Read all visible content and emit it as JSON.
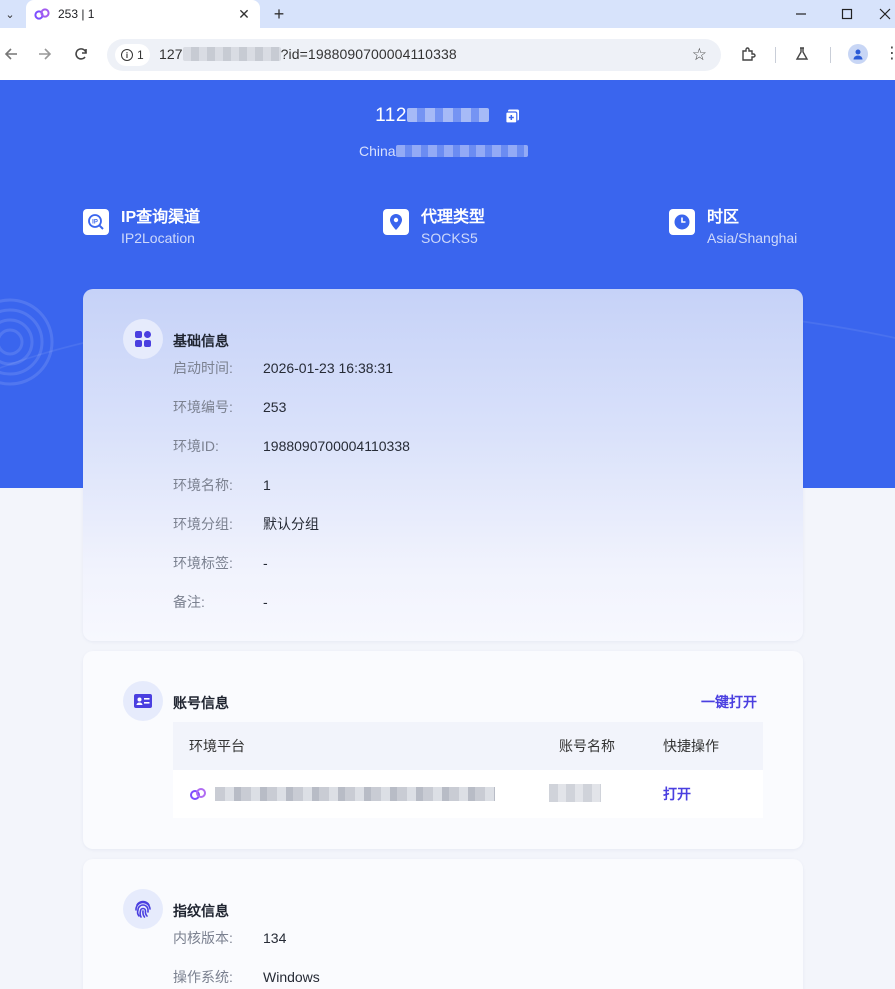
{
  "browser": {
    "tab_title": "253 | 1",
    "tab_caret": "⌄",
    "tab_close": "✕",
    "new_tab": "+",
    "site_info_count": "1",
    "url_prefix": "127",
    "url_suffix": "?id=1988090700004110338"
  },
  "proxy": {
    "ip_prefix": "112",
    "location_prefix": "China"
  },
  "stats": [
    {
      "label": "IP查询渠道",
      "value": "IP2Location",
      "icon": "ip-search-icon"
    },
    {
      "label": "代理类型",
      "value": "SOCKS5",
      "icon": "location-pin-icon"
    },
    {
      "label": "时区",
      "value": "Asia/Shanghai",
      "icon": "clock-icon"
    }
  ],
  "basic": {
    "title": "基础信息",
    "rows": [
      {
        "key": "启动时间:",
        "value": "2026-01-23 16:38:31"
      },
      {
        "key": "环境编号:",
        "value": "253"
      },
      {
        "key": "环境ID:",
        "value": "1988090700004110338"
      },
      {
        "key": "环境名称:",
        "value": "1"
      },
      {
        "key": "环境分组:",
        "value": "默认分组"
      },
      {
        "key": "环境标签:",
        "value": "-"
      },
      {
        "key": "备注:",
        "value": "-"
      }
    ]
  },
  "account": {
    "title": "账号信息",
    "open_all": "一键打开",
    "columns": [
      "环境平台",
      "账号名称",
      "快捷操作"
    ],
    "row_action": "打开"
  },
  "fingerprint": {
    "title": "指纹信息",
    "rows": [
      {
        "key": "内核版本:",
        "value": "134"
      },
      {
        "key": "操作系统:",
        "value": "Windows"
      }
    ]
  },
  "colors": {
    "hero": "#3a65ee",
    "accent": "#4a3fe0",
    "brand_purple": "#7c4dff"
  }
}
